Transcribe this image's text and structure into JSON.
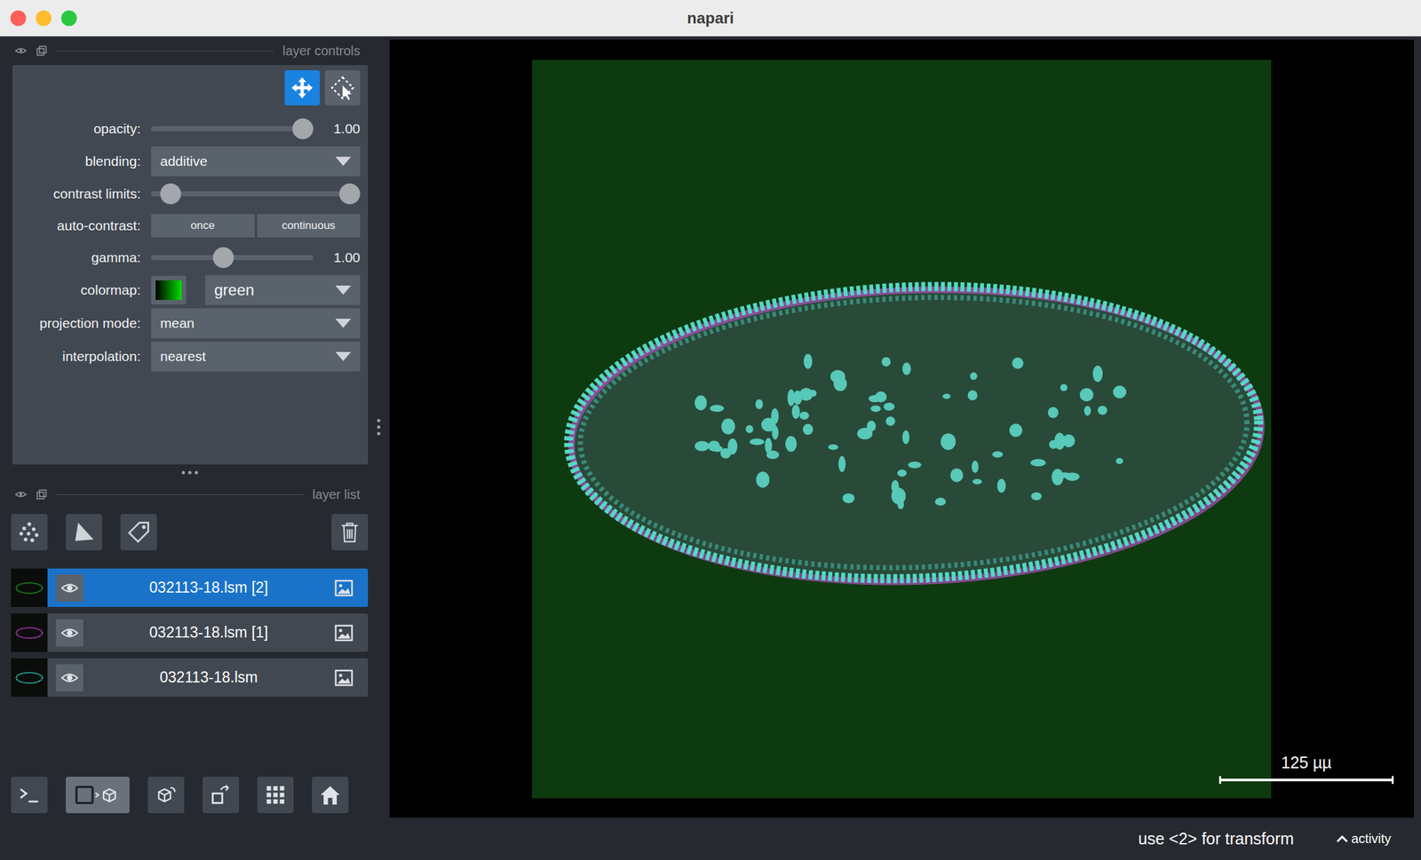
{
  "window": {
    "title": "napari"
  },
  "layer_controls": {
    "header": "layer controls",
    "tools": [
      {
        "kind": "move",
        "selected": true
      },
      {
        "kind": "transform",
        "selected": false
      }
    ],
    "rows": [
      {
        "kind": "slider",
        "label": "opacity:",
        "level": 1.0,
        "reading": "1.00"
      },
      {
        "kind": "dropdown",
        "label": "blending:",
        "value": "additive"
      },
      {
        "kind": "range",
        "label": "contrast limits:",
        "low": 0.05,
        "high": 1.0
      },
      {
        "kind": "buttons",
        "label": "auto-contrast:",
        "buttons": [
          "once",
          "continuous"
        ]
      },
      {
        "kind": "slider",
        "label": "gamma:",
        "level": 0.44,
        "reading": "1.00"
      },
      {
        "kind": "colormap",
        "label": "colormap:",
        "value": "green",
        "color": "#00e000"
      },
      {
        "kind": "dropdown",
        "label": "projection mode:",
        "value": "mean"
      },
      {
        "kind": "dropdown",
        "label": "interpolation:",
        "value": "nearest"
      }
    ]
  },
  "layer_list": {
    "header": "layer list",
    "layers": [
      {
        "name": "032113-18.lsm [2]",
        "selected": true,
        "visible": true,
        "color": "#1f9a2a"
      },
      {
        "name": "032113-18.lsm [1]",
        "selected": false,
        "visible": true,
        "color": "#c040c8"
      },
      {
        "name": "032113-18.lsm",
        "selected": false,
        "visible": true,
        "color": "#30d0c0"
      }
    ]
  },
  "viewer": {
    "scale_bar": "125 µµ",
    "ndisplay_3d": false
  },
  "status_bar": {
    "message": "use <2> for transform",
    "activity": "activity"
  }
}
